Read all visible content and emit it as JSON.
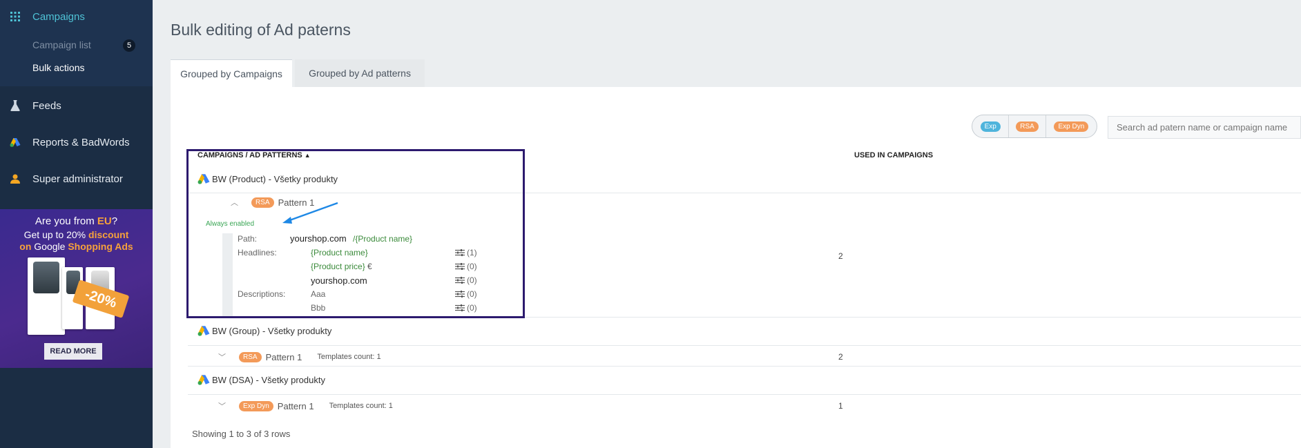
{
  "sidebar": {
    "campaigns_label": "Campaigns",
    "campaign_list_label": "Campaign list",
    "campaign_list_count": "5",
    "bulk_actions_label": "Bulk actions",
    "feeds_label": "Feeds",
    "reports_label": "Reports & BadWords",
    "admin_label": "Super administrator"
  },
  "promo": {
    "line1_prefix": "Are you from ",
    "line1_highlight": "EU",
    "line1_suffix": "?",
    "line2_prefix": "Get up to 20% ",
    "line2_highlight": "discount",
    "line3_prefix": "on",
    "line3_mid": " Google ",
    "line3_highlight": "Shopping Ads",
    "discount_badge": "-20%",
    "read_more": "READ MORE"
  },
  "page": {
    "title": "Bulk editing of Ad paterns"
  },
  "tabs": [
    {
      "label": "Grouped by Campaigns",
      "active": true
    },
    {
      "label": "Grouped by Ad patterns",
      "active": false
    }
  ],
  "filters": [
    {
      "label": "Exp",
      "color": "#4fb4dc"
    },
    {
      "label": "RSA",
      "color": "#f39a59"
    },
    {
      "label": "Exp Dyn",
      "color": "#f39a59"
    }
  ],
  "search": {
    "placeholder": "Search ad patern name or campaign name"
  },
  "table": {
    "header_campaigns": "CAMPAIGNS / AD PATTERNS",
    "header_used": "USED IN CAMPAIGNS",
    "rows": [
      {
        "campaign": "BW (Product) - Všetky produkty",
        "pattern": {
          "type": "RSA",
          "name": "Pattern 1",
          "status": "Always enabled",
          "path_label": "Path:",
          "path_domain": "yourshop.com",
          "path_value": "/{Product name}",
          "headlines_label": "Headlines:",
          "headlines": [
            {
              "text": "{Product name}",
              "suffix": "",
              "uses": "(1)",
              "green": true
            },
            {
              "text": "{Product price}",
              "suffix": " €",
              "uses": "(0)",
              "green": true
            },
            {
              "text": "yourshop.com",
              "suffix": "",
              "uses": "(0)",
              "green": false
            }
          ],
          "descriptions_label": "Descriptions:",
          "descriptions": [
            {
              "text": "Aaa",
              "uses": "(0)"
            },
            {
              "text": "Bbb",
              "uses": "(0)"
            }
          ],
          "used": "2"
        }
      },
      {
        "campaign": "BW (Group) - Všetky produkty",
        "pattern": {
          "type": "RSA",
          "name": "Pattern 1",
          "templates": "Templates count: 1",
          "used": "2"
        }
      },
      {
        "campaign": "BW (DSA) - Všetky produkty",
        "pattern": {
          "type": "Exp Dyn",
          "name": "Pattern 1",
          "templates": "Templates count: 1",
          "used": "1"
        }
      }
    ]
  },
  "footer": {
    "showing": "Showing 1 to 3 of 3 rows"
  }
}
